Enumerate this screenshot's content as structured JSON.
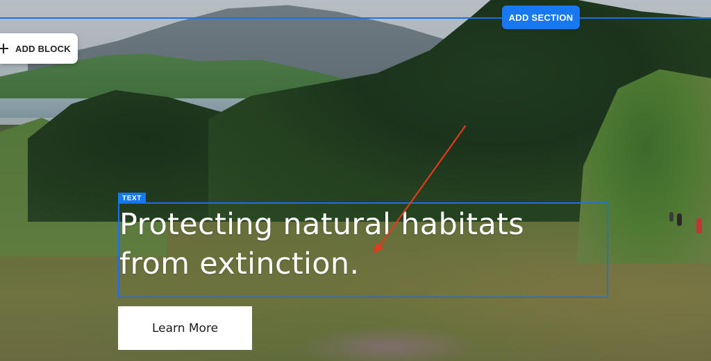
{
  "editor": {
    "add_section_label": "ADD SECTION",
    "add_block_label": "ADD BLOCK",
    "text_block_tag": "TEXT",
    "accent_color": "#1778f2"
  },
  "hero": {
    "headline": "Protecting natural habitats from extinction.",
    "cta_label": "Learn More"
  },
  "icons": {
    "add_block": "plus-icon",
    "annotation": "arrow-annotation"
  },
  "annotation": {
    "color": "#e8391d"
  }
}
